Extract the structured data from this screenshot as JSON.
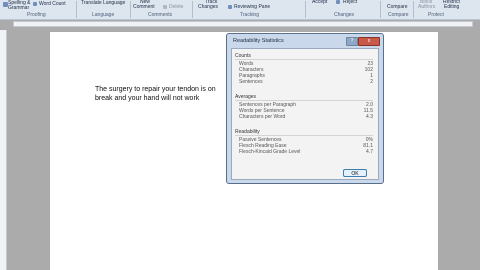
{
  "ribbon": {
    "spelling": "Spelling &",
    "grammar": "Grammar",
    "word_count": "Word Count",
    "translate_language": "Translate Language",
    "new_comment": "New",
    "comment_word": "Comment",
    "delete_label": "Delete",
    "track_changes_top": "Track",
    "track_changes_bottom": "Changes",
    "reviewing_pane": "Reviewing Pane",
    "accept": "Accept",
    "reject": "Reject",
    "compare": "Compare",
    "block_authors": "Block",
    "authors": "Authors",
    "restrict": "Restrict",
    "editing": "Editing",
    "groups": {
      "proofing": "Proofing",
      "language": "Language",
      "comments": "Comments",
      "tracking": "Tracking",
      "changes": "Changes",
      "compare": "Compare",
      "protect": "Protect"
    }
  },
  "document": {
    "line1": "The surgery to repair your tendon is on",
    "line2": "break and your hand will not work"
  },
  "dialog": {
    "title": "Readability Statistics",
    "help": "?",
    "close": "x",
    "sections": {
      "counts": "Counts",
      "averages": "Averages",
      "readability": "Readability"
    },
    "counts": [
      {
        "label": "Words",
        "value": "23"
      },
      {
        "label": "Characters",
        "value": "102"
      },
      {
        "label": "Paragraphs",
        "value": "1"
      },
      {
        "label": "Sentences",
        "value": "2"
      }
    ],
    "averages": [
      {
        "label": "Sentences per Paragraph",
        "value": "2.0"
      },
      {
        "label": "Words per Sentence",
        "value": "11.5"
      },
      {
        "label": "Characters per Word",
        "value": "4.3"
      }
    ],
    "readability": [
      {
        "label": "Passive Sentences",
        "value": "0%"
      },
      {
        "label": "Flesch Reading Ease",
        "value": "81.1"
      },
      {
        "label": "Flesch-Kincaid Grade Level",
        "value": "4.7"
      }
    ],
    "ok": "OK"
  },
  "colors": {
    "ribbon_bg": "#dde5ef",
    "dialog_frame": "#c9d8ea",
    "close_button": "#c85a4a",
    "workspace": "#ababab"
  }
}
